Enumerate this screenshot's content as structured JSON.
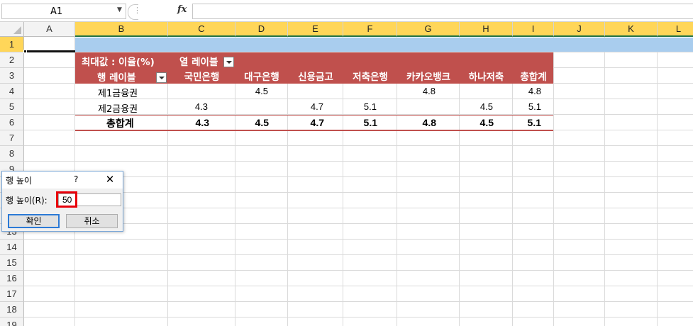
{
  "formula_bar": {
    "name_box": "A1",
    "fx_label": "fx",
    "formula": ""
  },
  "columns": [
    "A",
    "B",
    "C",
    "D",
    "E",
    "F",
    "G",
    "H",
    "I",
    "J",
    "K",
    "L"
  ],
  "rows": [
    "1",
    "2",
    "3",
    "4",
    "5",
    "6",
    "7",
    "8",
    "9",
    "10",
    "11",
    "12",
    "13",
    "14",
    "15",
    "16",
    "17",
    "18",
    "19"
  ],
  "pivot": {
    "value_field": "최대값 : 이율(%)",
    "column_labels": "열 레이블",
    "row_labels": "행 레이블",
    "headers": [
      "국민은행",
      "대구은행",
      "신용금고",
      "저축은행",
      "카카오뱅크",
      "하나저축",
      "총합계"
    ],
    "rows": [
      {
        "label": "제1금융권",
        "values": [
          "",
          "4.5",
          "",
          "",
          "4.8",
          "",
          "4.8"
        ]
      },
      {
        "label": "제2금융권",
        "values": [
          "4.3",
          "",
          "4.7",
          "5.1",
          "",
          "4.5",
          "5.1"
        ]
      }
    ],
    "total": {
      "label": "총합계",
      "values": [
        "4.3",
        "4.5",
        "4.7",
        "5.1",
        "4.8",
        "4.5",
        "5.1"
      ]
    },
    "accent_color": "#c0504d"
  },
  "dialog": {
    "title": "행 높이",
    "help": "?",
    "close": "✕",
    "label": "행 높이(R):",
    "value": "50",
    "ok": "확인",
    "cancel": "취소"
  }
}
